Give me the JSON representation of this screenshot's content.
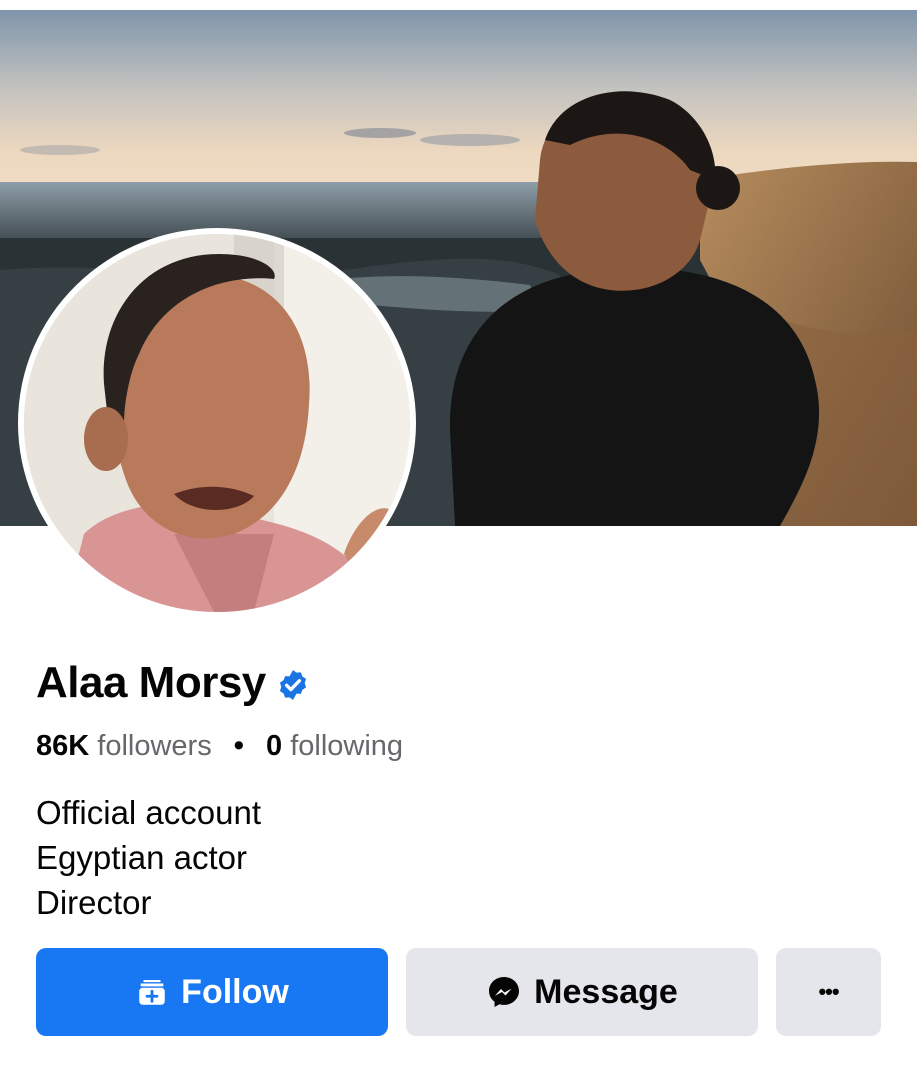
{
  "profile": {
    "name": "Alaa Morsy",
    "verified_icon": "verified-badge-icon",
    "verified_color": "#1b74e4",
    "followers_count": "86K",
    "followers_label": "followers",
    "separator": "•",
    "following_count": "0",
    "following_label": "following",
    "bio_lines": [
      "Official account",
      "Egyptian actor",
      "Director"
    ]
  },
  "actions": {
    "follow_label": "Follow",
    "follow_icon": "follow-add-icon",
    "message_label": "Message",
    "message_icon": "messenger-icon",
    "more_label": "•••",
    "more_icon": "more-options-icon"
  },
  "colors": {
    "accent": "#1877f2",
    "secondary_button": "#e4e6eb",
    "muted_text": "#65676b"
  }
}
